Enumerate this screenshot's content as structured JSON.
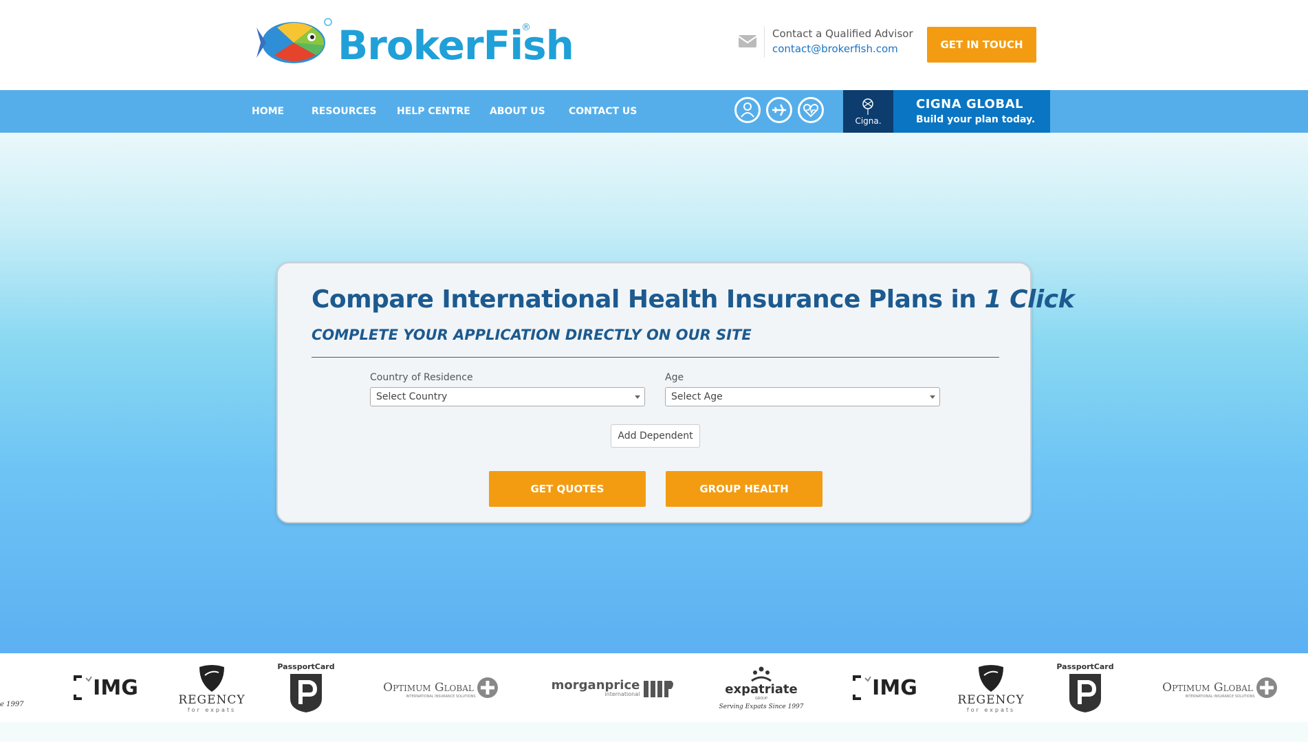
{
  "header": {
    "brand": "BrokerFish",
    "registered": "®",
    "contact_label": "Contact a Qualified Advisor",
    "contact_email": "contact@brokerfish.com",
    "cta_label": "GET IN TOUCH"
  },
  "nav": {
    "items": [
      {
        "label": "HOME"
      },
      {
        "label": "RESOURCES"
      },
      {
        "label": "HELP CENTRE"
      },
      {
        "label": "ABOUT US"
      },
      {
        "label": "CONTACT US"
      }
    ],
    "icons": [
      "expat-person-icon",
      "travel-plane-icon",
      "health-heart-icon"
    ]
  },
  "cigna": {
    "logo_text": "Cigna.",
    "title": "CIGNA GLOBAL",
    "subtitle": "Build your plan today."
  },
  "card": {
    "title_main": "Compare International Health Insurance Plans in ",
    "title_emphasis": "1 Click",
    "subtitle": "COMPLETE YOUR APPLICATION DIRECTLY ON OUR SITE",
    "country_label": "Country of Residence",
    "country_value": "Select Country",
    "age_label": "Age",
    "age_value": "Select Age",
    "add_dependent": "Add Dependent",
    "get_quotes": "GET QUOTES",
    "group_health": "GROUP HEALTH"
  },
  "partners": {
    "img": "IMG",
    "regency_name": "REGENCY",
    "regency_tag": "for expats",
    "passport": "PassportCard",
    "optimum": "Optimum Global",
    "optimum_tag": "INTERNATIONAL INSURANCE SOLUTIONS",
    "morgan": "morganprice",
    "morgan_tag": "international",
    "expatriate": "expatriate",
    "expatriate_group": "GROUP",
    "expatriate_tag": "Serving Expats Since 1997",
    "partial_tag": "e 1997"
  },
  "colors": {
    "accent_orange": "#f39c12",
    "nav_blue": "#55aeea",
    "title_blue": "#1c5a8f",
    "cigna_blue": "#0a75c2"
  }
}
